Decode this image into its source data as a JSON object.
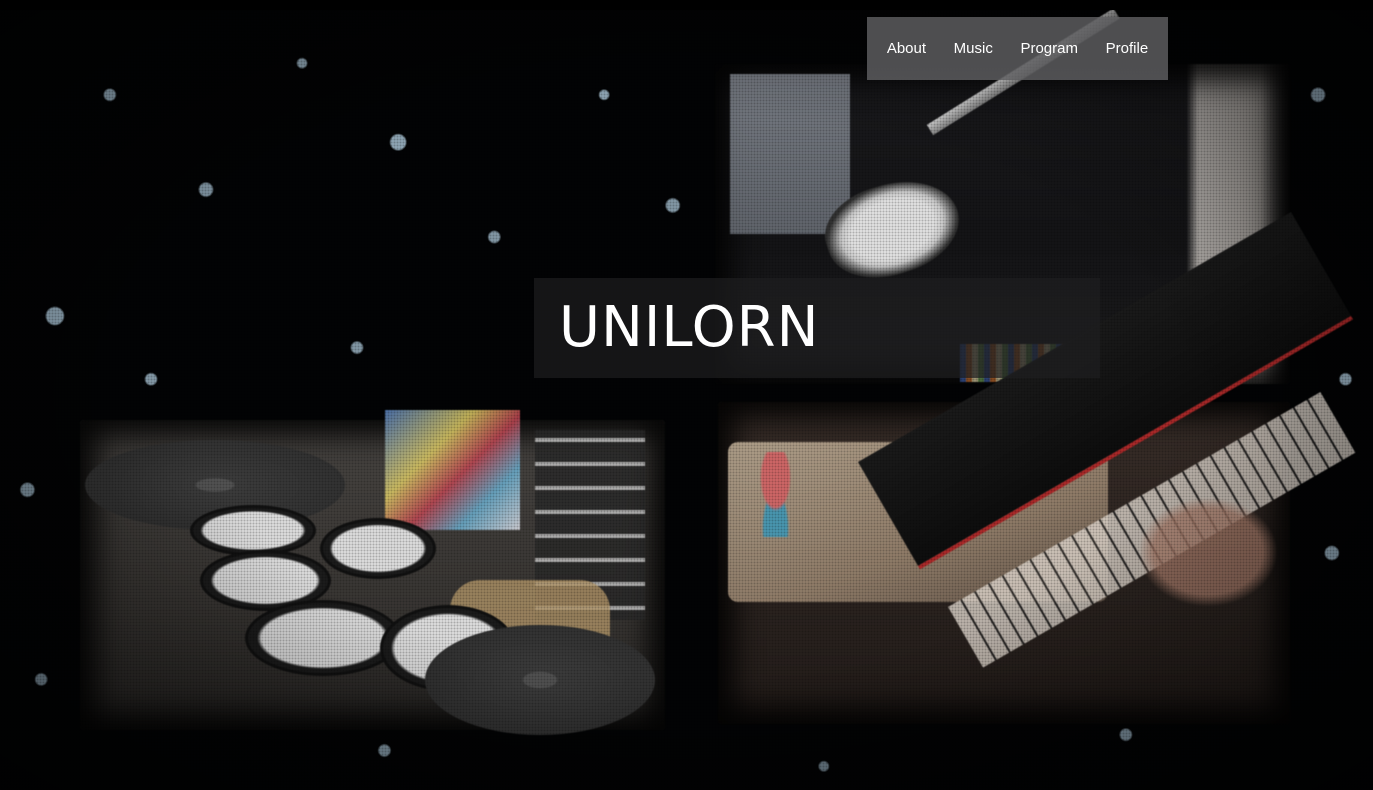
{
  "site": {
    "title": "UNILORN"
  },
  "nav": {
    "items": [
      {
        "label": "About"
      },
      {
        "label": "Music"
      },
      {
        "label": "Program"
      },
      {
        "label": "Profile"
      }
    ]
  },
  "hero": {
    "background": "collage of bass, drum and piano performance video stills with falling snowflakes",
    "colors": {
      "nav_bg": "#5f5f62",
      "title_band_bg": "#1e1e20",
      "title_text": "#ffffff",
      "page_bg": "#000000"
    }
  }
}
